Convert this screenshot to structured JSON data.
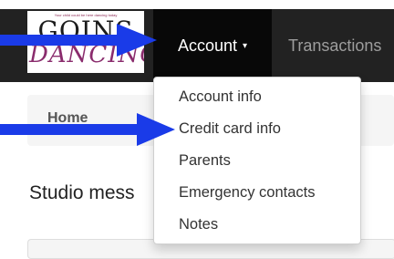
{
  "logo": {
    "tagline": "Your child could be here dancing today",
    "line1": "GOINS",
    "line2": "DANCING"
  },
  "navbar": {
    "account_label": "Account",
    "caret": "▾",
    "transactions_label": "Transactions"
  },
  "breadcrumb": {
    "home_label": "Home"
  },
  "main": {
    "studio_messages_label": "Studio mess"
  },
  "dropdown": {
    "items": [
      {
        "label": "Account info"
      },
      {
        "label": "Credit card info"
      },
      {
        "label": "Parents"
      },
      {
        "label": "Emergency contacts"
      },
      {
        "label": "Notes"
      }
    ]
  },
  "colors": {
    "navbar": "#222222",
    "nav_active": "#080808",
    "arrow": "#1a3be8"
  },
  "icons": [
    "right-arrow-icon",
    "right-arrow-icon"
  ]
}
